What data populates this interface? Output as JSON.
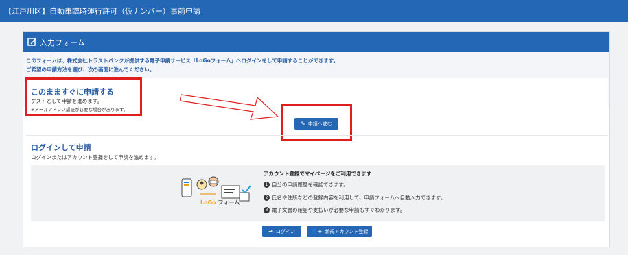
{
  "header": {
    "title": "【江戸川区】自動車臨時運行許可（仮ナンバー）事前申請"
  },
  "form_card": {
    "title": "入力フォーム"
  },
  "intro": {
    "line1": "このフォームは、株式会社トラストバンクが提供する電子申請サービス「LoGoフォーム」へログインをして申請することができます。",
    "line2": "ご希望の申請方法を選び、次の画面に進んでください。"
  },
  "guest": {
    "title": "このまますぐに申請する",
    "description": "ゲストとして申請を進めます。",
    "note": "※メールアドレス認証が必要な場合があります。",
    "button_label": "申請へ進む"
  },
  "login": {
    "title": "ログインして申請",
    "description": "ログインまたはアカウント登録をして申請を進めます。",
    "promo_heading": "アカウント登録でマイページをご利用できます",
    "promo_items": [
      {
        "num": "1",
        "text": "自分の申請履歴を確認できます。"
      },
      {
        "num": "2",
        "text": "氏名や住所などの登録内容を利用して、申請フォームへ自動入力できます。"
      },
      {
        "num": "3",
        "text": "電子文書の確認や支払いが必要な申請もすぐわかります。"
      }
    ],
    "logo": {
      "part1": "LoGo",
      "part2": "フォーム"
    },
    "login_button": "ログイン",
    "register_button": "新規アカウント登録"
  },
  "colors": {
    "primary": "#2467b4",
    "annotation_red": "#e01e1e",
    "heading_blue": "#2a5fa6"
  }
}
